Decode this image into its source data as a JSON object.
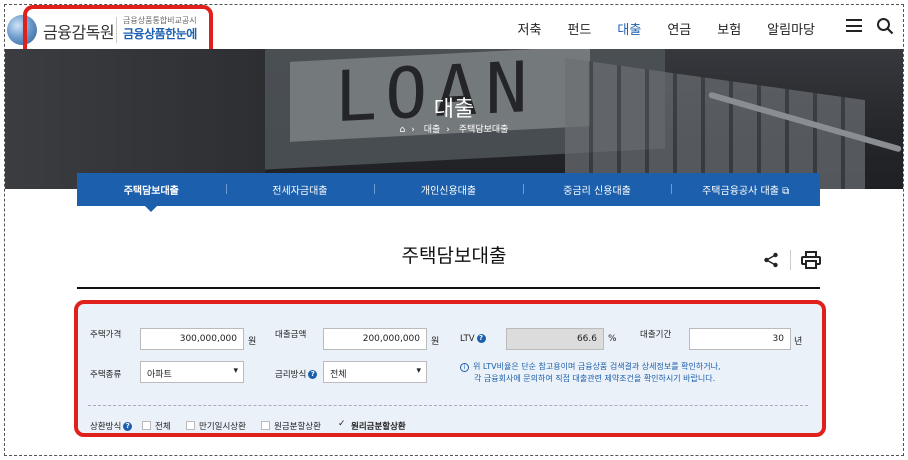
{
  "header": {
    "logo_text": "금융감독원",
    "logo_sub_small": "금융상품통합비교공시",
    "logo_sub_big": "금융상품한눈에",
    "nav": [
      {
        "label": "저축",
        "active": false
      },
      {
        "label": "펀드",
        "active": false
      },
      {
        "label": "대출",
        "active": true
      },
      {
        "label": "연금",
        "active": false
      },
      {
        "label": "보험",
        "active": false
      },
      {
        "label": "알림마당",
        "active": false
      }
    ],
    "icons": [
      "hamburger-menu-icon",
      "search-icon"
    ]
  },
  "hero": {
    "background_text": "LOAN",
    "title": "대출",
    "breadcrumb": [
      "대출",
      "주택담보대출"
    ]
  },
  "tabs": [
    {
      "label": "주택담보대출",
      "active": true
    },
    {
      "label": "전세자금대출",
      "active": false
    },
    {
      "label": "개인신용대출",
      "active": false
    },
    {
      "label": "중금리 신용대출",
      "active": false
    },
    {
      "label": "주택금융공사 대출",
      "active": false
    }
  ],
  "page": {
    "title": "주택담보대출",
    "tools": [
      "share-icon",
      "print-icon"
    ]
  },
  "form": {
    "house_price": {
      "label": "주택가격",
      "value": "300,000,000",
      "unit": "원"
    },
    "loan_amount": {
      "label": "대출금액",
      "value": "200,000,000",
      "unit": "원"
    },
    "ltv": {
      "label": "LTV",
      "value": "66.6",
      "unit": "%"
    },
    "loan_period": {
      "label": "대출기간",
      "value": "30",
      "unit": "년"
    },
    "house_type": {
      "label": "주택종류",
      "value": "아파트"
    },
    "rate_type": {
      "label": "금리방식",
      "value": "전체"
    },
    "notice": [
      "위 LTV비율은 단순 참고용이며 금융상품 검색결과 상세정보를 확인하거나,",
      "각 금융회사에 문의하여 직접 대출관련 제약조건을 확인하시기 바랍니다."
    ],
    "repayment": {
      "label": "상환방식",
      "options": [
        {
          "label": "전체",
          "checked": false
        },
        {
          "label": "만기일시상환",
          "checked": false
        },
        {
          "label": "원금분할상환",
          "checked": false
        },
        {
          "label": "원리금분할상환",
          "checked": true
        }
      ]
    }
  },
  "colors": {
    "brand_blue": "#1c5fad",
    "highlight_red": "#e0201c"
  }
}
